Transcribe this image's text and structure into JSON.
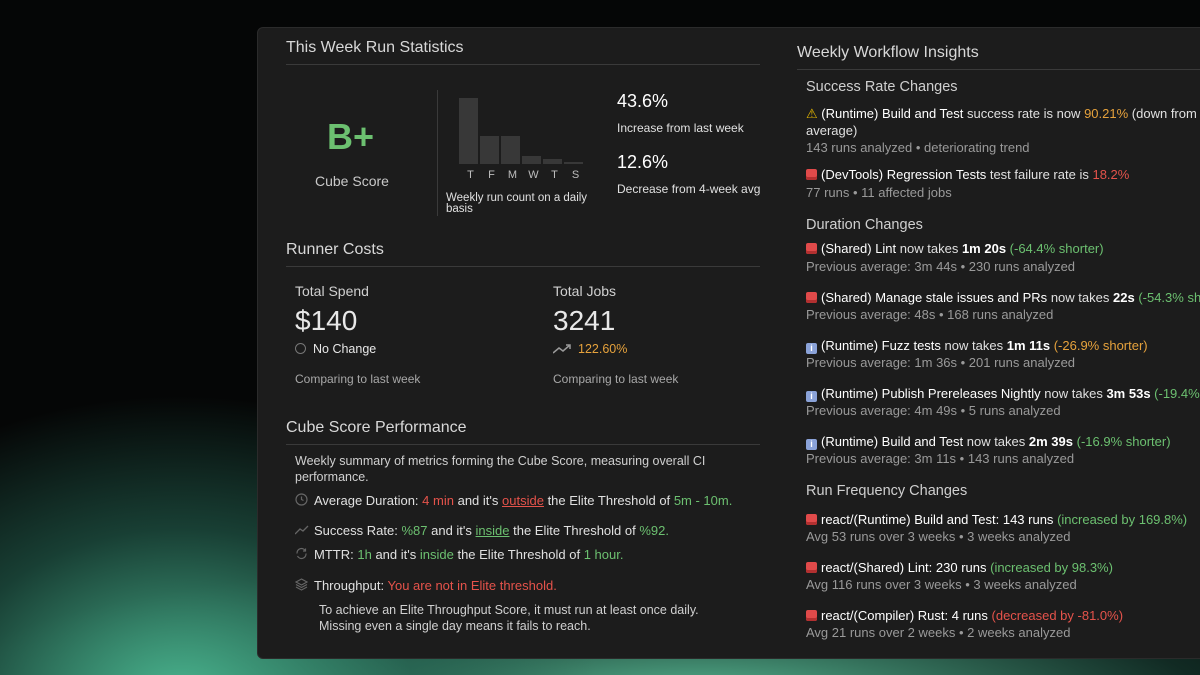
{
  "left": {
    "stats_title": "This Week Run Statistics",
    "grade": "B+",
    "grade_label": "Cube Score",
    "days": [
      "T",
      "F",
      "M",
      "W",
      "T",
      "S"
    ],
    "bar_levels": [
      1.0,
      0.42,
      0.42,
      0.12,
      0.08,
      0.03
    ],
    "chart_caption": "Weekly run count on a daily basis",
    "stat1_value": "43.6%",
    "stat1_label": "Increase from last week",
    "stat2_value": "12.6%",
    "stat2_label": "Decrease from 4-week avg",
    "costs_title": "Runner Costs",
    "spend_label": "Total Spend",
    "spend_value": "$140",
    "spend_change": "No Change",
    "spend_compare": "Comparing to last week",
    "jobs_label": "Total Jobs",
    "jobs_value": "3241",
    "jobs_change": "122.60%",
    "jobs_compare": "Comparing to last week",
    "perf_title": "Cube Score Performance",
    "perf_desc_1": "Weekly summary of metrics forming the Cube Score, measuring overall CI",
    "perf_desc_2": "performance.",
    "metrics": {
      "duration": {
        "label": "Average Duration:",
        "value": "4 min",
        "mid": "and it's",
        "status": "outside",
        "tail": "the Elite Threshold of",
        "threshold": "5m - 10m."
      },
      "success": {
        "label": "Success Rate:",
        "value": "%87",
        "mid": "and it's",
        "status": "inside",
        "tail": "the Elite Threshold of",
        "threshold": "%92."
      },
      "mttr": {
        "label": "MTTR:",
        "value": "1h",
        "mid": "and it's",
        "status": "inside",
        "tail": "the Elite Threshold of",
        "threshold": "1 hour."
      },
      "throughput": {
        "label": "Throughput:",
        "value": "You are not in Elite threshold.",
        "note_1": "To achieve an Elite Throughput Score, it must run at least once daily.",
        "note_2": "Missing even a single day means it fails to reach."
      }
    }
  },
  "right": {
    "title": "Weekly Workflow Insights",
    "success_title": "Success Rate Changes",
    "s1": {
      "name": "(Runtime) Build and Test",
      "mid": "success rate is now",
      "value": "90.21%",
      "tail": "(down from",
      "line2": "average)",
      "meta": "143 runs analyzed • deteriorating trend"
    },
    "s2": {
      "name": "(DevTools) Regression Tests",
      "mid": "test failure rate is",
      "value": "18.2%",
      "meta": "77 runs • 11 affected jobs"
    },
    "duration_title": "Duration Changes",
    "d1": {
      "name": "(Shared) Lint",
      "mid": "now takes",
      "time": "1m 20s",
      "change": "(-64.4% shorter)",
      "meta": "Previous average: 3m 44s • 230 runs analyzed"
    },
    "d2": {
      "name": "(Shared) Manage stale issues and PRs",
      "mid": "now takes",
      "time": "22s",
      "change": "(-54.3% sho",
      "meta": "Previous average: 48s • 168 runs analyzed"
    },
    "d3": {
      "name": "(Runtime) Fuzz tests",
      "mid": "now takes",
      "time": "1m 11s",
      "change": "(-26.9% shorter)",
      "meta": "Previous average: 1m 36s • 201 runs analyzed"
    },
    "d4": {
      "name": "(Runtime) Publish Prereleases Nightly",
      "mid": "now takes",
      "time": "3m 53s",
      "change": "(-19.4%",
      "meta": "Previous average: 4m 49s • 5 runs analyzed"
    },
    "d5": {
      "name": "(Runtime) Build and Test",
      "mid": "now takes",
      "time": "2m 39s",
      "change": "(-16.9% shorter)",
      "meta": "Previous average: 3m 11s • 143 runs analyzed"
    },
    "freq_title": "Run Frequency Changes",
    "f1": {
      "name": "react/(Runtime) Build and Test: 143 runs",
      "change": "(increased by 169.8%)",
      "meta": "Avg 53 runs over 3 weeks • 3 weeks analyzed"
    },
    "f2": {
      "name": "react/(Shared) Lint: 230 runs",
      "change": "(increased by 98.3%)",
      "meta": "Avg 116 runs over 3 weeks • 3 weeks analyzed"
    },
    "f3": {
      "name": "react/(Compiler) Rust: 4 runs",
      "change": "(decreased by -81.0%)",
      "meta": "Avg 21 runs over 2 weeks • 2 weeks analyzed"
    }
  }
}
